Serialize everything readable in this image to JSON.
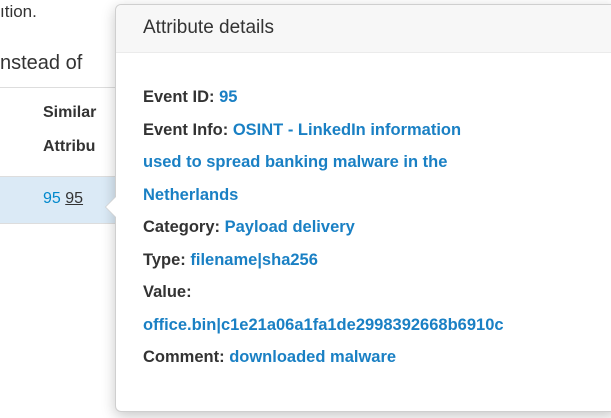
{
  "background": {
    "top_fragment": "ıtion.",
    "instead_fragment": "nstead of",
    "table": {
      "header_line1": "Similar",
      "header_line2": "Attribu",
      "row_value_plain": "95",
      "row_value_link": "95"
    }
  },
  "popover": {
    "title": "Attribute details",
    "fields": {
      "event_id_label": "Event ID:",
      "event_id_value": "95",
      "event_info_label": "Event Info:",
      "event_info_value_line1": "OSINT - LinkedIn information",
      "event_info_value_line2": "used to spread banking malware in the",
      "event_info_value_line3": "Netherlands",
      "category_label": "Category:",
      "category_value": "Payload delivery",
      "type_label": "Type:",
      "type_value": "filename|sha256",
      "value_label": "Value:",
      "value_value": "office.bin|c1e21a06a1fa1de2998392668b6910c",
      "comment_label": "Comment:",
      "comment_value": "downloaded malware"
    }
  },
  "colors": {
    "link": "#1a80c4",
    "selected_row": "#dbeaf6",
    "popover_title_bg": "#f7f7f7"
  }
}
